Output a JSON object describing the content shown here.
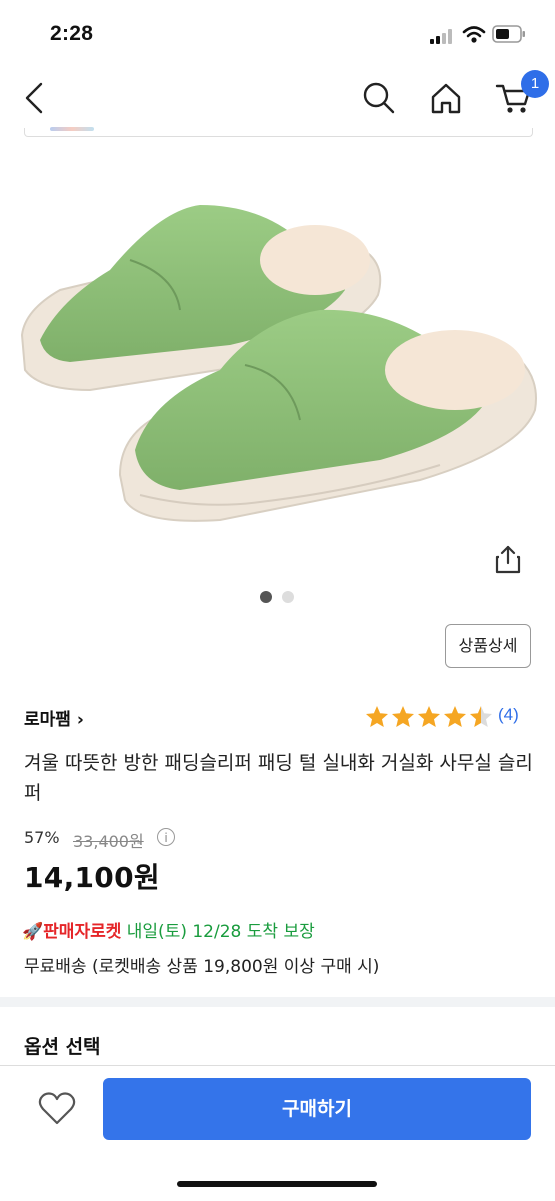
{
  "status_bar": {
    "time": "2:28"
  },
  "nav": {
    "icons": [
      "back-icon",
      "search-icon",
      "home-icon",
      "cart-icon"
    ],
    "cart_count": "1"
  },
  "gallery": {
    "current_index": 1,
    "total": 2,
    "detail_button": "상품상세"
  },
  "product": {
    "seller": "로마팸",
    "rating": 4.5,
    "reviews": "(4)",
    "title": "겨울 따뜻한 방한 패딩슬리퍼 패딩 털 실내화 거실화 사무실 슬리퍼",
    "discount": "57%",
    "original_price": "33,400원",
    "price": "14,100원",
    "rocket_label": "🚀판매자로켓",
    "delivery": "내일(토) 12/28 도착 보장",
    "shipping": "무료배송 (로켓배송 상품 19,800원 이상 구매 시)"
  },
  "option_section": {
    "title": "옵션 선택"
  },
  "footer": {
    "buy_button": "구매하기"
  },
  "colors": {
    "accent": "#3474ea",
    "rocket_red": "#e52528",
    "delivery_green": "#1a9c3e",
    "star": "#f5a623",
    "slipper": "#8fbf78"
  }
}
